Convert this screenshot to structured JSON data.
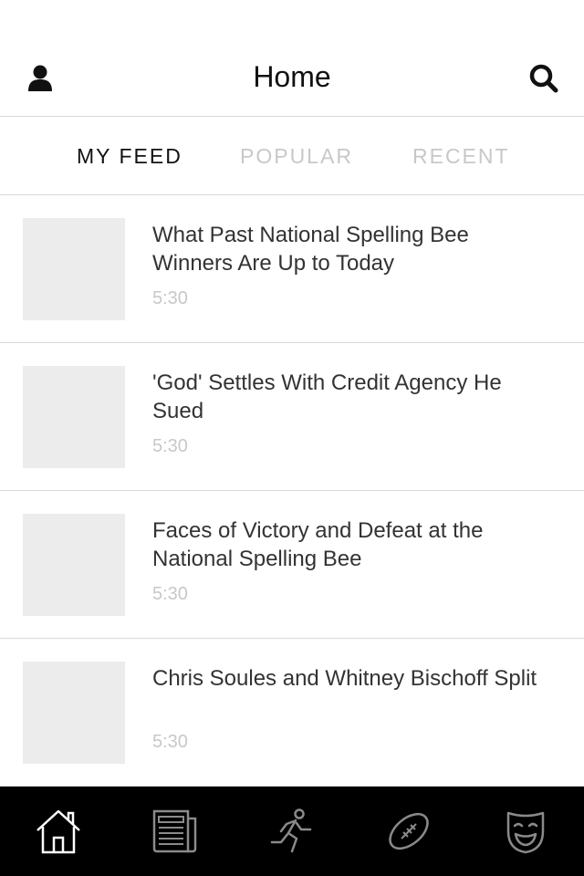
{
  "nav": {
    "title": "Home",
    "left_icon": "user-icon",
    "right_icon": "search-icon"
  },
  "tabs": [
    {
      "label": "MY FEED",
      "active": true
    },
    {
      "label": "POPULAR",
      "active": false
    },
    {
      "label": "RECENT",
      "active": false
    }
  ],
  "feed": {
    "items": [
      {
        "title": "What Past National Spelling Bee Winners Are Up to Today",
        "duration": "5:30"
      },
      {
        "title": "'God' Settles With Credit Agency He Sued",
        "duration": "5:30"
      },
      {
        "title": "Faces of Victory and Defeat at the National Spelling Bee",
        "duration": "5:30"
      },
      {
        "title": "Chris Soules and Whitney Bischoff Split",
        "duration": "5:30"
      }
    ]
  },
  "tab_bar": {
    "items": [
      {
        "icon": "home-icon",
        "active": true
      },
      {
        "icon": "newspaper-icon",
        "active": false
      },
      {
        "icon": "runner-icon",
        "active": false
      },
      {
        "icon": "football-icon",
        "active": false
      },
      {
        "icon": "theater-mask-icon",
        "active": false
      }
    ]
  },
  "colors": {
    "accent_active": "#ffffff",
    "icon_inactive": "#8a8a8a",
    "tab_active": "#111111",
    "tab_inactive": "#c8c8c8",
    "thumb_placeholder": "#ececec",
    "tab_bar_bg": "#000000"
  }
}
